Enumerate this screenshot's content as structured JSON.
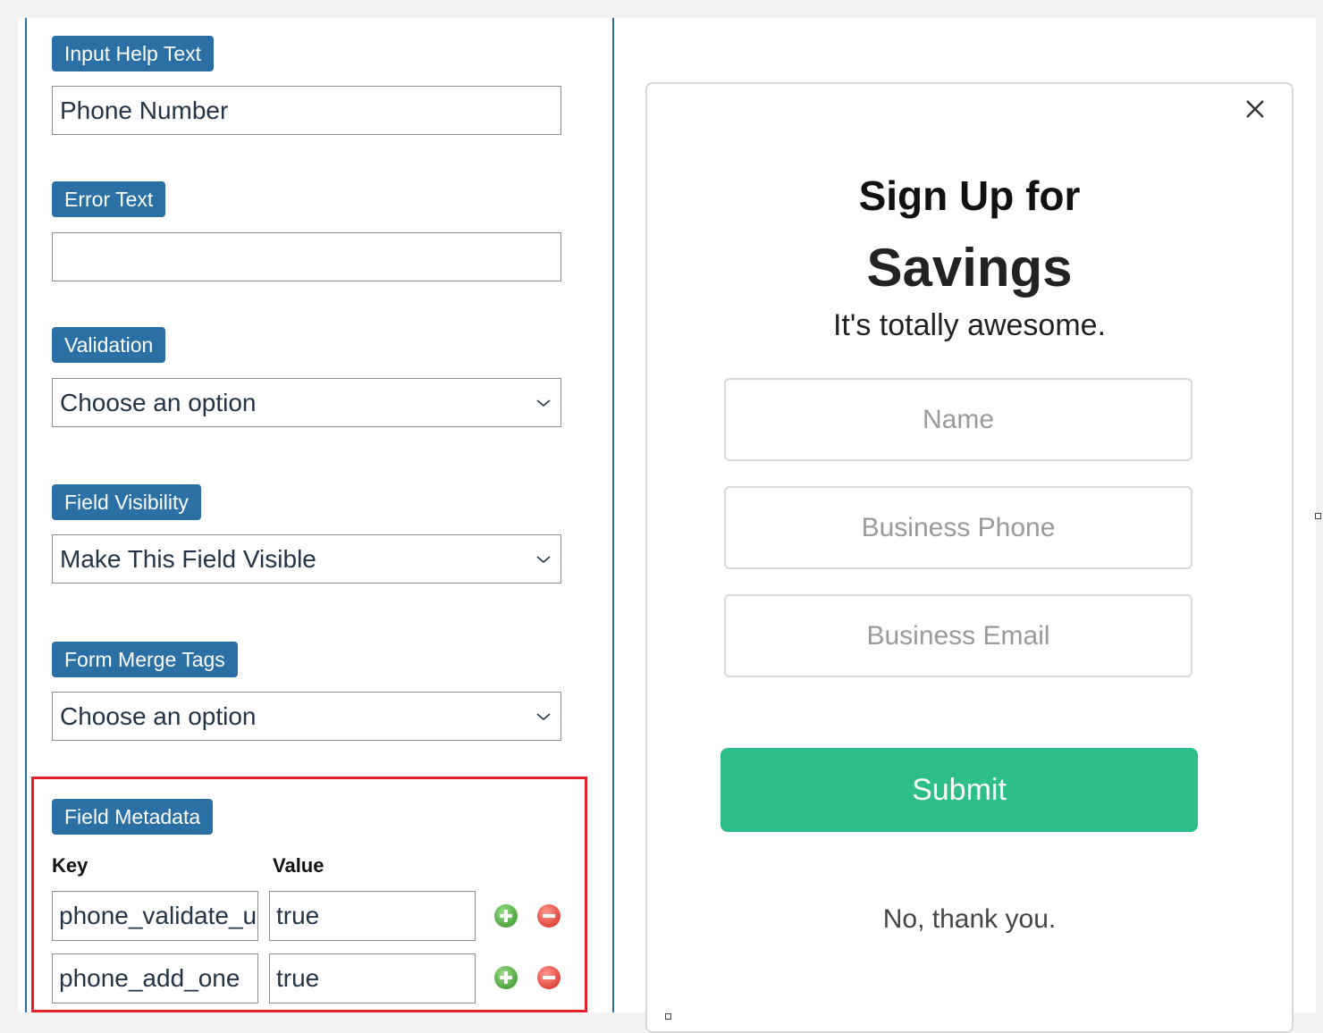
{
  "settings": {
    "help_text": {
      "label": "Input Help Text",
      "value": "Phone Number"
    },
    "error_text": {
      "label": "Error Text",
      "value": ""
    },
    "validation": {
      "label": "Validation",
      "selected": "Choose an option"
    },
    "visibility": {
      "label": "Field Visibility",
      "selected": "Make This Field Visible"
    },
    "merge_tags": {
      "label": "Form Merge Tags",
      "selected": "Choose an option"
    },
    "metadata": {
      "label": "Field Metadata",
      "key_header": "Key",
      "value_header": "Value",
      "rows": [
        {
          "key": "phone_validate_u",
          "value": "true"
        },
        {
          "key": "phone_add_one",
          "value": "true"
        }
      ]
    }
  },
  "preview": {
    "close_icon": "close-icon",
    "title_line1": "Sign Up for",
    "title_line2": "Savings",
    "subtitle": "It's totally awesome.",
    "fields": [
      {
        "placeholder": "Name"
      },
      {
        "placeholder": "Business Phone"
      },
      {
        "placeholder": "Business Email"
      }
    ],
    "submit_label": "Submit",
    "decline_label": "No, thank you.",
    "colors": {
      "submit": "#2dbf87",
      "badge": "#2a70a4",
      "highlight": "#e3202a"
    }
  }
}
